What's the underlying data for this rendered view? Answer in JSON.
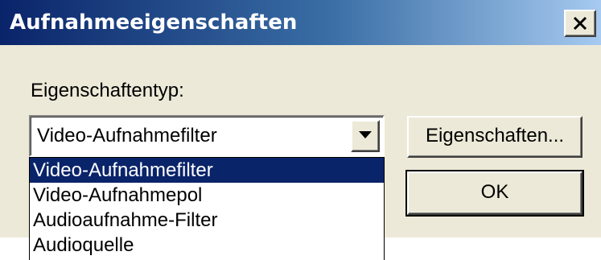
{
  "window": {
    "title": "Aufnahmeeigenschaften",
    "close_icon": "close-icon"
  },
  "form": {
    "type_label": "Eigenschaftentyp:",
    "combo": {
      "selected_value": "Video-Aufnahmefilter",
      "arrow_icon": "chevron-down-icon"
    },
    "options": [
      {
        "label": "Video-Aufnahmefilter",
        "selected": true
      },
      {
        "label": "Video-Aufnahmepol",
        "selected": false
      },
      {
        "label": "Audioaufnahme-Filter",
        "selected": false
      },
      {
        "label": "Audioquelle",
        "selected": false
      }
    ]
  },
  "buttons": {
    "properties_label": "Eigenschaften...",
    "ok_label": "OK"
  },
  "colors": {
    "titlebar_start": "#0a246a",
    "titlebar_end": "#a6caf0",
    "dialog_background": "#ece9d8",
    "selection_highlight": "#0a246a"
  }
}
